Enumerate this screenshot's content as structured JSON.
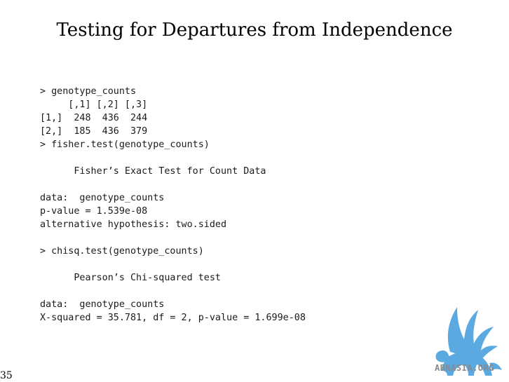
{
  "slide": {
    "title": "Testing for Departures from Independence",
    "page_number": "35"
  },
  "console": {
    "lines": [
      "> genotype_counts",
      "     [,1] [,2] [,3]",
      "[1,]  248  436  244",
      "[2,]  185  436  379",
      "> fisher.test(genotype_counts)",
      "",
      "      Fisher’s Exact Test for Count Data",
      "",
      "data:  genotype_counts",
      "p-value = 1.539e-08",
      "alternative hypothesis: two.sided",
      "",
      "> chisq.test(genotype_counts)",
      "",
      "      Pearson’s Chi-squared test",
      "",
      "data:  genotype_counts",
      "X-squared = 35.781, df = 2, p-value = 1.699e-08"
    ]
  },
  "watermark": {
    "text": "ABNASIA.ORG",
    "color": "#5aa9e0",
    "text_color": "#8a8a8a",
    "icon": "griffin-logo-icon"
  }
}
